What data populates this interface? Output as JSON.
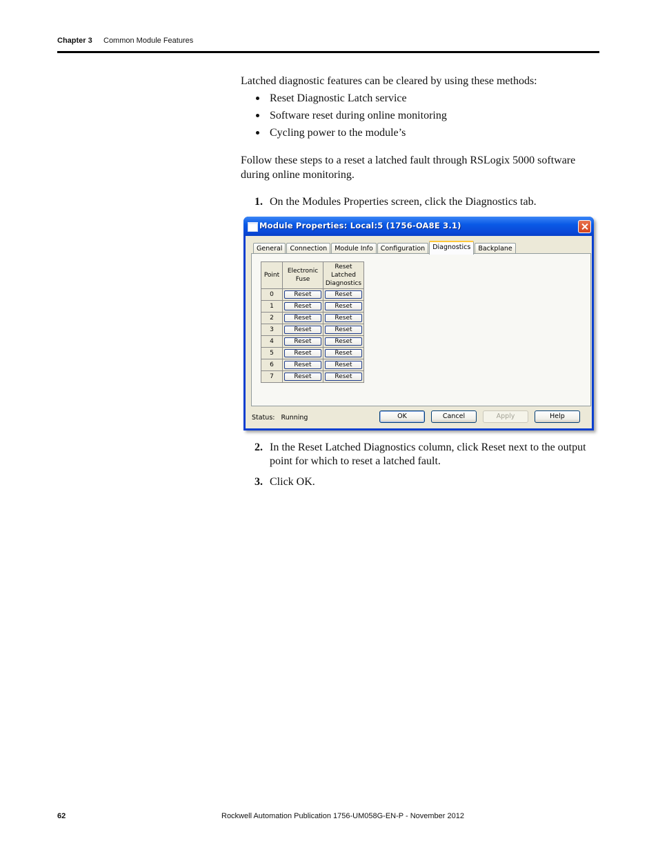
{
  "header": {
    "chapter": "Chapter 3",
    "section": "Common Module Features"
  },
  "content": {
    "intro": "Latched diagnostic features can be cleared by using these methods:",
    "methods": [
      "Reset Diagnostic Latch service",
      "Software reset during online monitoring",
      "Cycling power to the module’s"
    ],
    "steps_intro": "Follow these steps to a reset a latched fault through RSLogix 5000 software during online monitoring.",
    "steps": [
      {
        "num": "1.",
        "text": "On the Modules Properties screen, click the Diagnostics tab."
      },
      {
        "num": "2.",
        "text": "In the Reset Latched Diagnostics column, click Reset next to the output point for which to reset a latched fault."
      },
      {
        "num": "3.",
        "text": "Click OK."
      }
    ]
  },
  "dialog": {
    "title": "Module Properties: Local:5 (1756-OA8E 3.1)",
    "tabs": [
      {
        "label": "General",
        "active": false
      },
      {
        "label": "Connection",
        "active": false
      },
      {
        "label": "Module Info",
        "active": false
      },
      {
        "label": "Configuration",
        "active": false
      },
      {
        "label": "Diagnostics",
        "active": true
      },
      {
        "label": "Backplane",
        "active": false
      }
    ],
    "table": {
      "columns": [
        "Point",
        "Electronic Fuse",
        "Reset Latched Diagnostics"
      ],
      "rows": [
        {
          "point": "0",
          "fuse": "Reset",
          "latched": "Reset"
        },
        {
          "point": "1",
          "fuse": "Reset",
          "latched": "Reset"
        },
        {
          "point": "2",
          "fuse": "Reset",
          "latched": "Reset"
        },
        {
          "point": "3",
          "fuse": "Reset",
          "latched": "Reset"
        },
        {
          "point": "4",
          "fuse": "Reset",
          "latched": "Reset"
        },
        {
          "point": "5",
          "fuse": "Reset",
          "latched": "Reset"
        },
        {
          "point": "6",
          "fuse": "Reset",
          "latched": "Reset"
        },
        {
          "point": "7",
          "fuse": "Reset",
          "latched": "Reset"
        }
      ]
    },
    "status_label": "Status:",
    "status_value": "Running",
    "buttons": {
      "ok": "OK",
      "cancel": "Cancel",
      "apply": "Apply",
      "help": "Help"
    },
    "icons": {
      "window": "window-icon",
      "close": "close-icon"
    }
  },
  "footer": {
    "page_number": "62",
    "publication": "Rockwell Automation Publication 1756-UM058G-EN-P - November 2012"
  }
}
